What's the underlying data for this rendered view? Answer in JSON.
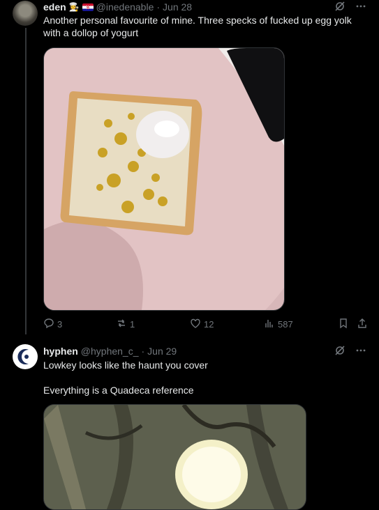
{
  "tweets": [
    {
      "name": "eden",
      "emoji": "👩‍🍳",
      "flag_name": "croatia-flag",
      "handle": "@inedenable",
      "dot": "·",
      "date": "Jun 28",
      "text": "Another personal favourite of mine. Three specks of fucked up egg yolk with a dollop of yogurt",
      "image_alt": "toast-with-egg-yolk-and-yogurt-photo",
      "actions": {
        "replies": "3",
        "reposts": "1",
        "likes": "12",
        "views": "587"
      }
    },
    {
      "name": "hyphen",
      "handle": "@hyphen_c_",
      "dot": "·",
      "date": "Jun 29",
      "text_line1": "Lowkey looks like the haunt you cover",
      "text_line2": "Everything is a Quadeca reference",
      "image_alt": "haunt-album-cover-art"
    }
  ],
  "icons": {
    "grok": "grok-icon",
    "more": "more-icon",
    "reply": "reply-icon",
    "repost": "repost-icon",
    "like": "like-icon",
    "views": "views-icon",
    "bookmark": "bookmark-icon",
    "share": "share-icon"
  }
}
